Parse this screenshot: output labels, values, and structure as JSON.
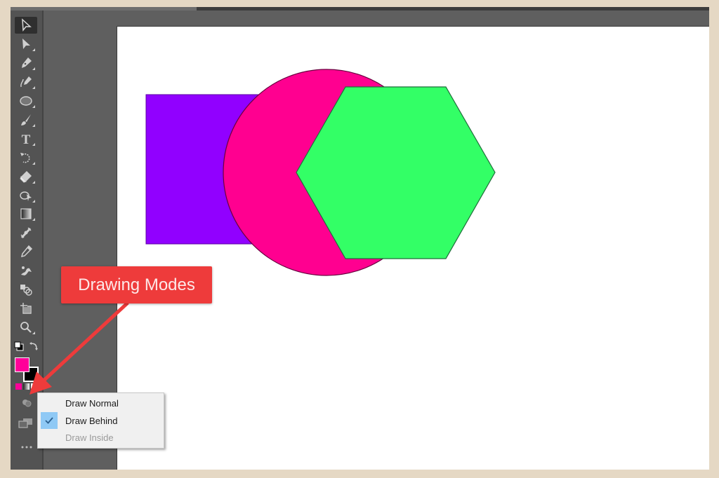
{
  "app": {
    "toolbar": {
      "tools": [
        {
          "name": "selection-tool",
          "icon": "selection-arrow-icon",
          "active": true
        },
        {
          "name": "direct-selection-tool",
          "icon": "direct-selection-arrow-icon"
        },
        {
          "name": "pen-tool",
          "icon": "pen-icon"
        },
        {
          "name": "curvature-tool",
          "icon": "curvature-pen-icon"
        },
        {
          "name": "ellipse-tool",
          "icon": "ellipse-icon"
        },
        {
          "name": "paintbrush-tool",
          "icon": "paintbrush-icon"
        },
        {
          "name": "type-tool",
          "icon": "type-icon",
          "glyph": "T"
        },
        {
          "name": "rotate-tool",
          "icon": "rotate-icon"
        },
        {
          "name": "eraser-tool",
          "icon": "eraser-icon"
        },
        {
          "name": "shape-builder-tool",
          "icon": "shape-builder-icon"
        },
        {
          "name": "gradient-tool",
          "icon": "gradient-icon"
        },
        {
          "name": "width-tool",
          "icon": "width-icon"
        },
        {
          "name": "eyedropper-tool",
          "icon": "eyedropper-icon"
        },
        {
          "name": "puppet-warp-tool",
          "icon": "puppet-warp-icon"
        },
        {
          "name": "blend-tool",
          "icon": "blend-icon"
        },
        {
          "name": "artboard-tool",
          "icon": "artboard-icon"
        },
        {
          "name": "zoom-tool",
          "icon": "magnifier-icon"
        }
      ],
      "fill_color": "#ff0099",
      "stroke_color": "#000000"
    },
    "callout": {
      "label": "Drawing Modes",
      "color": "#ee3b3b"
    },
    "drawing_mode_menu": {
      "items": [
        {
          "label": "Draw Normal",
          "checked": false,
          "disabled": false
        },
        {
          "label": "Draw Behind",
          "checked": true,
          "disabled": false
        },
        {
          "label": "Draw Inside",
          "checked": false,
          "disabled": true
        }
      ]
    },
    "artwork": {
      "rectangle_color": "#9100ff",
      "circle_color": "#ff0090",
      "hexagon_color": "#33ff66"
    }
  }
}
